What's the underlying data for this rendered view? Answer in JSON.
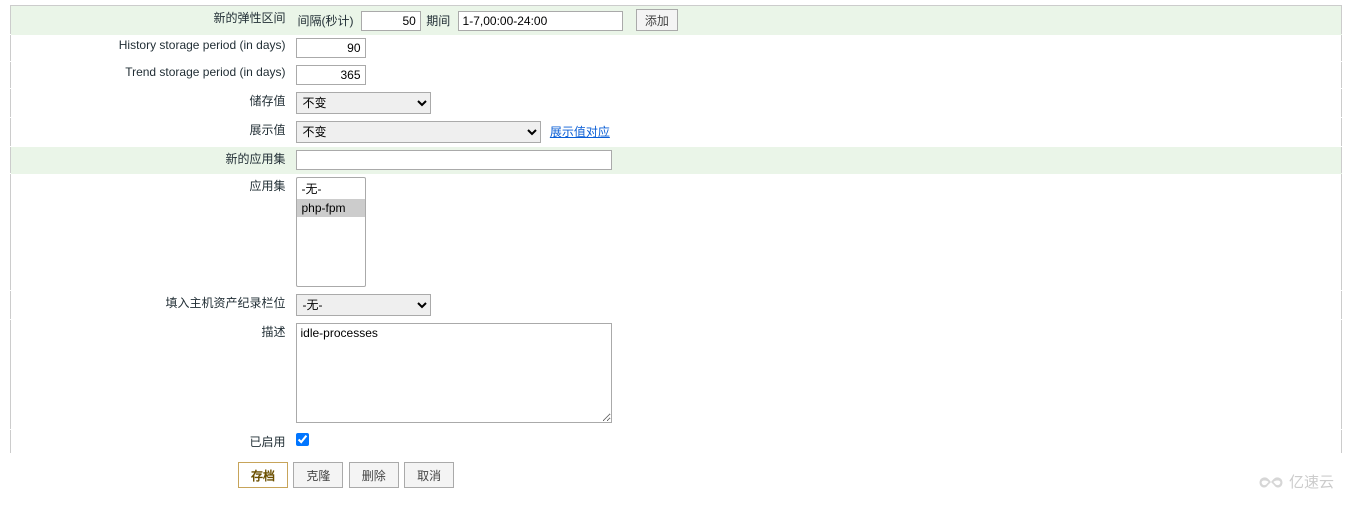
{
  "form": {
    "flex_intervals": {
      "label": "新的弹性区间",
      "interval_label": "间隔(秒计)",
      "interval_value": "50",
      "period_label": "期间",
      "period_value": "1-7,00:00-24:00",
      "add_label": "添加"
    },
    "history": {
      "label": "History storage period (in days)",
      "value": "90"
    },
    "trends": {
      "label": "Trend storage period (in days)",
      "value": "365"
    },
    "store_value": {
      "label": "储存值",
      "selected": "不变"
    },
    "show_value": {
      "label": "展示值",
      "selected": "不变",
      "map_link": "展示值对应"
    },
    "new_app": {
      "label": "新的应用集",
      "value": ""
    },
    "applications": {
      "label": "应用集",
      "options": [
        "-无-",
        "php-fpm"
      ],
      "selected": "php-fpm"
    },
    "inventory": {
      "label": "填入主机资产纪录栏位",
      "selected": "-无-"
    },
    "description": {
      "label": "描述",
      "value": "idle-processes"
    },
    "enabled": {
      "label": "已启用",
      "checked": true
    }
  },
  "buttons": {
    "save": "存档",
    "clone": "克隆",
    "delete": "删除",
    "cancel": "取消"
  },
  "watermark": "亿速云"
}
